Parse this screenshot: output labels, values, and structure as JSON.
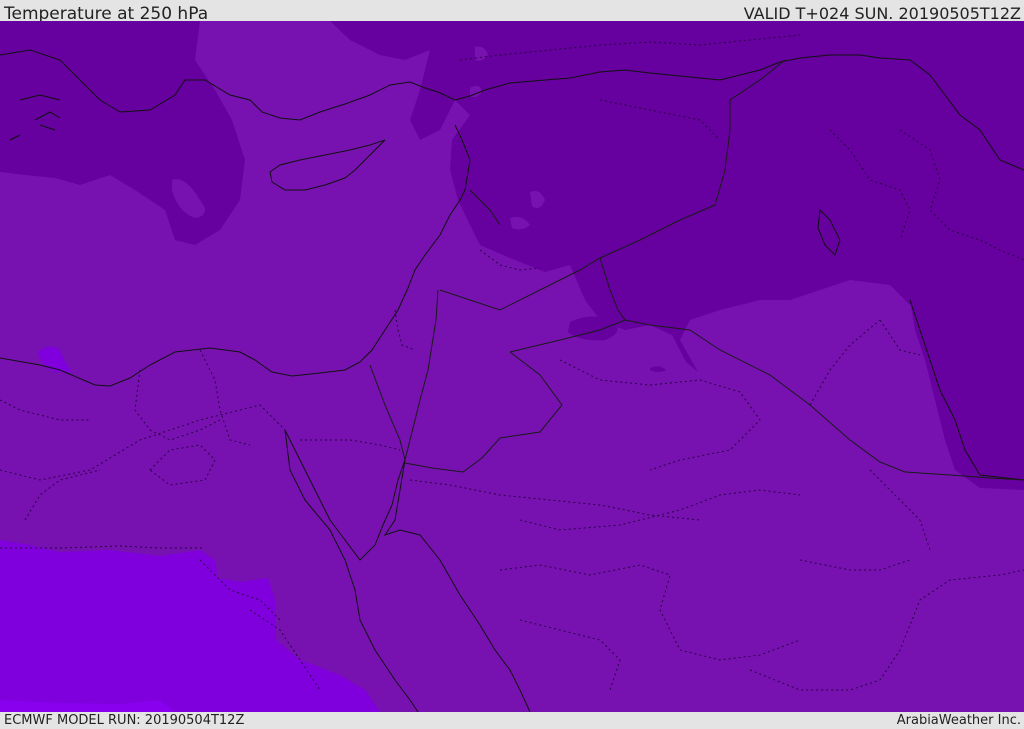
{
  "header": {
    "title": "Temperature at 250 hPa",
    "valid_time": "VALID T+024 SUN. 20190505T12Z"
  },
  "footer": {
    "model_run": "ECMWF MODEL RUN: 20190504T12Z",
    "brand": "ArabiaWeather Inc."
  },
  "colors": {
    "base_field": "#7712b0",
    "cold_field": "#66009e",
    "warm_field": "#7f00dd",
    "warmest_field": "#8800ee",
    "coastline": "#111111",
    "border": "#1a1a1a"
  },
  "icons": {
    "map": "temperature-field-map"
  }
}
